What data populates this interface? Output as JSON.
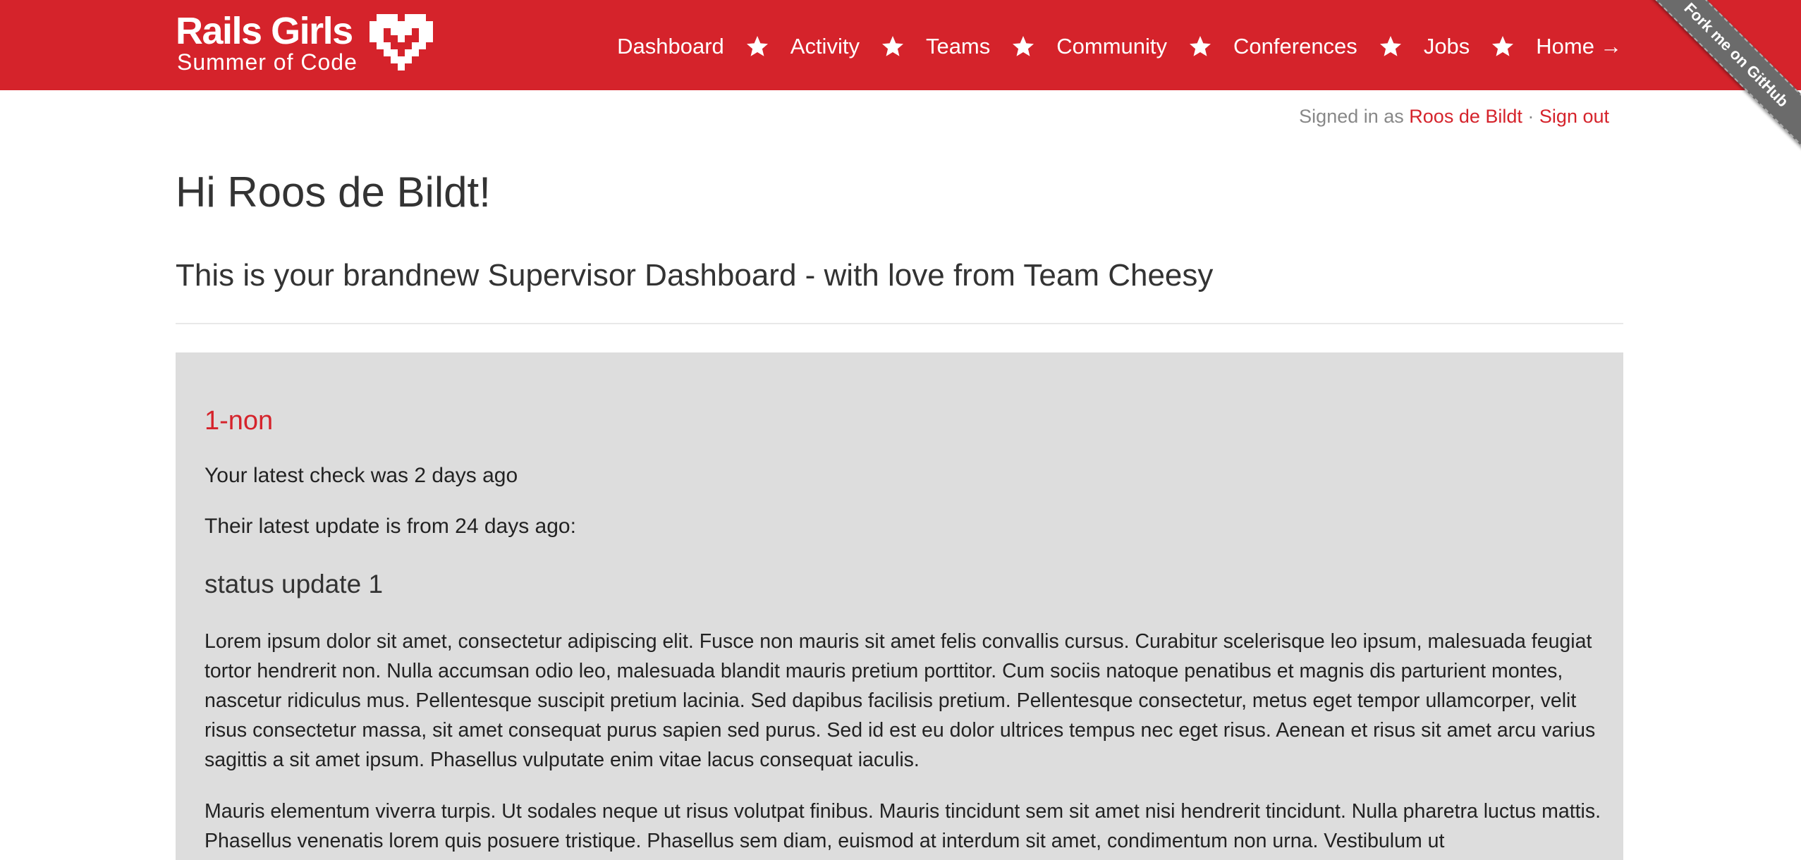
{
  "colors": {
    "brand": "#d5232b",
    "card_bg": "#dddddd",
    "ribbon": "#6b6b6b"
  },
  "header": {
    "logo_title": "Rails Girls",
    "logo_subtitle": "Summer of Code",
    "logo_icon": "pixel-heart-icon",
    "nav": [
      {
        "label": "Dashboard"
      },
      {
        "label": "Activity"
      },
      {
        "label": "Teams"
      },
      {
        "label": "Community"
      },
      {
        "label": "Conferences"
      },
      {
        "label": "Jobs"
      },
      {
        "label": "Home",
        "icon": "arrow-right-icon",
        "arrow": "→"
      }
    ],
    "separator_icon": "star-icon",
    "ribbon": "Fork me on GitHub"
  },
  "session": {
    "signed_in_as": "Signed in as",
    "user": "Roos de Bildt",
    "separator": "·",
    "sign_out": "Sign out"
  },
  "main": {
    "greeting": "Hi Roos de Bildt!",
    "subtitle": "This is your brandnew Supervisor Dashboard - with love from Team Cheesy",
    "team": {
      "name": "1-non",
      "latest_check": "Your latest check was 2 days ago",
      "latest_update": "Their latest update is from 24 days ago:",
      "status_title": "status update 1",
      "paragraphs": [
        "Lorem ipsum dolor sit amet, consectetur adipiscing elit. Fusce non mauris sit amet felis convallis cursus. Curabitur scelerisque leo ipsum, malesuada feugiat tortor hendrerit non. Nulla accumsan odio leo, malesuada blandit mauris pretium porttitor. Cum sociis natoque penatibus et magnis dis parturient montes, nascetur ridiculus mus. Pellentesque suscipit pretium lacinia. Sed dapibus facilisis pretium. Pellentesque consectetur, metus eget tempor ullamcorper, velit risus consectetur massa, sit amet consequat purus sapien sed purus. Sed id est eu dolor ultrices tempus nec eget risus. Aenean et risus sit amet arcu varius sagittis a sit amet ipsum. Phasellus vulputate enim vitae lacus consequat iaculis.",
        "Mauris elementum viverra turpis. Ut sodales neque ut risus volutpat finibus. Mauris tincidunt sem sit amet nisi hendrerit tincidunt. Nulla pharetra luctus mattis. Phasellus venenatis lorem quis posuere tristique. Phasellus sem diam, euismod at interdum sit amet, condimentum non urna. Vestibulum ut"
      ]
    }
  }
}
